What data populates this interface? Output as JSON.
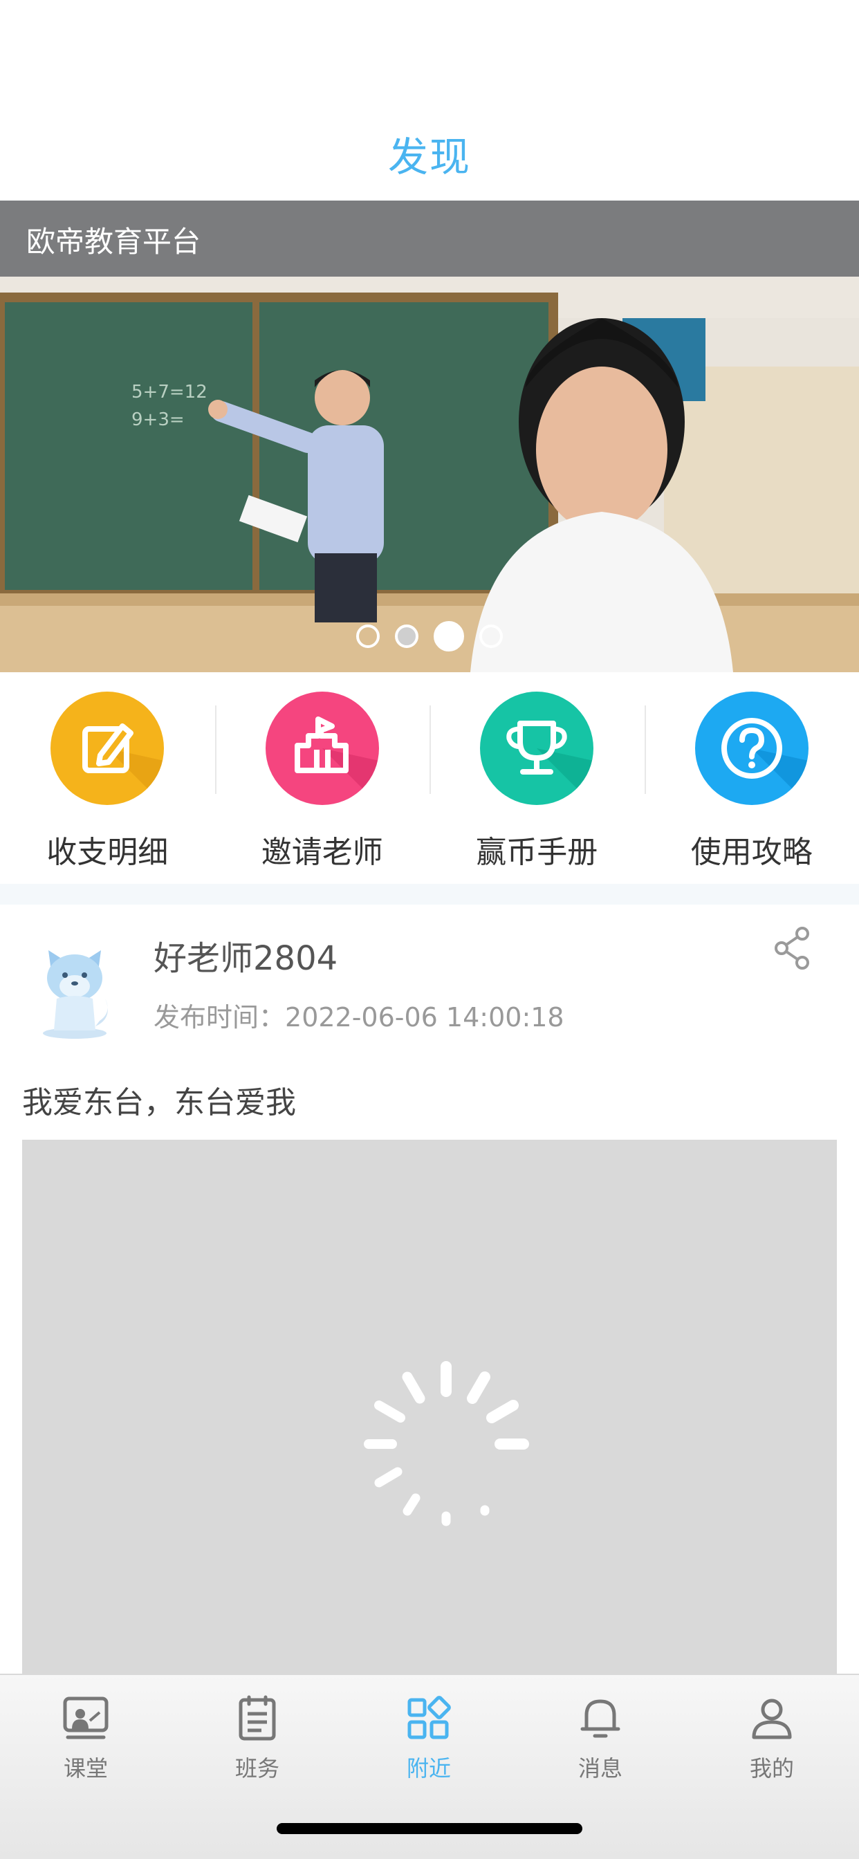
{
  "header": {
    "title": "发现"
  },
  "platform": {
    "name": "欧帝教育平台"
  },
  "banner": {
    "slide_count": 4,
    "active_index": 2
  },
  "quick_actions": [
    {
      "label": "收支明细",
      "icon": "edit-icon",
      "color": "#f5b31b"
    },
    {
      "label": "邀请老师",
      "icon": "building-flag-icon",
      "color": "#f5457f"
    },
    {
      "label": "赢币手册",
      "icon": "trophy-icon",
      "color": "#16c4a5"
    },
    {
      "label": "使用攻略",
      "icon": "help-icon",
      "color": "#1da9f2"
    }
  ],
  "post": {
    "author": "好老师2804",
    "time_label": "发布时间：",
    "time_value": "2022-06-06 14:00:18",
    "text": "我爱东台，东台爱我"
  },
  "tabbar": {
    "items": [
      {
        "label": "课堂",
        "icon": "classroom-icon"
      },
      {
        "label": "班务",
        "icon": "clipboard-icon"
      },
      {
        "label": "附近",
        "icon": "grid-apps-icon"
      },
      {
        "label": "消息",
        "icon": "bell-icon"
      },
      {
        "label": "我的",
        "icon": "user-icon"
      }
    ],
    "active_index": 2
  },
  "colors": {
    "accent": "#4ab4f0"
  }
}
